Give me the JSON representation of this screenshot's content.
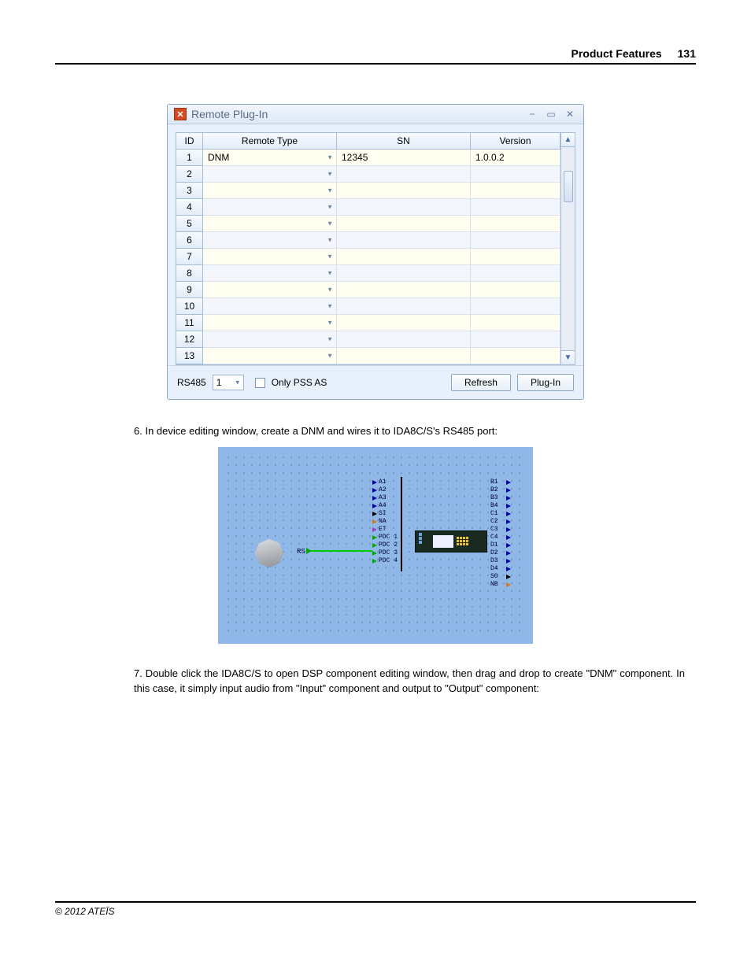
{
  "header": {
    "section": "Product Features",
    "page": "131"
  },
  "window": {
    "title": "Remote Plug-In",
    "columns": {
      "id": "ID",
      "type": "Remote Type",
      "sn": "SN",
      "version": "Version"
    },
    "rows": [
      {
        "id": "1",
        "type": "DNM",
        "sn": "12345",
        "version": "1.0.0.2"
      },
      {
        "id": "2",
        "type": "",
        "sn": "",
        "version": ""
      },
      {
        "id": "3",
        "type": "",
        "sn": "",
        "version": ""
      },
      {
        "id": "4",
        "type": "",
        "sn": "",
        "version": ""
      },
      {
        "id": "5",
        "type": "",
        "sn": "",
        "version": ""
      },
      {
        "id": "6",
        "type": "",
        "sn": "",
        "version": ""
      },
      {
        "id": "7",
        "type": "",
        "sn": "",
        "version": ""
      },
      {
        "id": "8",
        "type": "",
        "sn": "",
        "version": ""
      },
      {
        "id": "9",
        "type": "",
        "sn": "",
        "version": ""
      },
      {
        "id": "10",
        "type": "",
        "sn": "",
        "version": ""
      },
      {
        "id": "11",
        "type": "",
        "sn": "",
        "version": ""
      },
      {
        "id": "12",
        "type": "",
        "sn": "",
        "version": ""
      },
      {
        "id": "13",
        "type": "",
        "sn": "",
        "version": ""
      }
    ],
    "bottom": {
      "rs485_label": "RS485",
      "rs485_value": "1",
      "only_pss_label": "Only PSS AS",
      "refresh": "Refresh",
      "plugin": "Plug-In"
    }
  },
  "steps": {
    "s6": "6. In device editing window, create a DNM and wires it to IDA8C/S's RS485 port:",
    "s7": "7. Double click the IDA8C/S to open DSP component editing window, then drag and drop to create \"DNM\" component. In this case, it simply input audio from \"Input\" component and output to \"Output\" component:"
  },
  "diagram": {
    "rs_label": "RS",
    "mid_ports": [
      "A1",
      "A2",
      "A3",
      "A4",
      "SI",
      "NA",
      "ET",
      "PDC 1",
      "PDC 2",
      "PDC 3",
      "PDC 4"
    ],
    "mid_colors": [
      "b",
      "b",
      "b",
      "b",
      "k",
      "o",
      "p",
      "g",
      "g",
      "g",
      "g"
    ],
    "right_ports": [
      "B1",
      "B2",
      "B3",
      "B4",
      "C1",
      "C2",
      "C3",
      "C4",
      "D1",
      "D2",
      "D3",
      "D4",
      "SO",
      "NB"
    ],
    "right_colors": [
      "b",
      "b",
      "b",
      "b",
      "b",
      "b",
      "b",
      "b",
      "b",
      "b",
      "b",
      "b",
      "k",
      "o"
    ]
  },
  "footer": "© 2012 ATEÏS"
}
